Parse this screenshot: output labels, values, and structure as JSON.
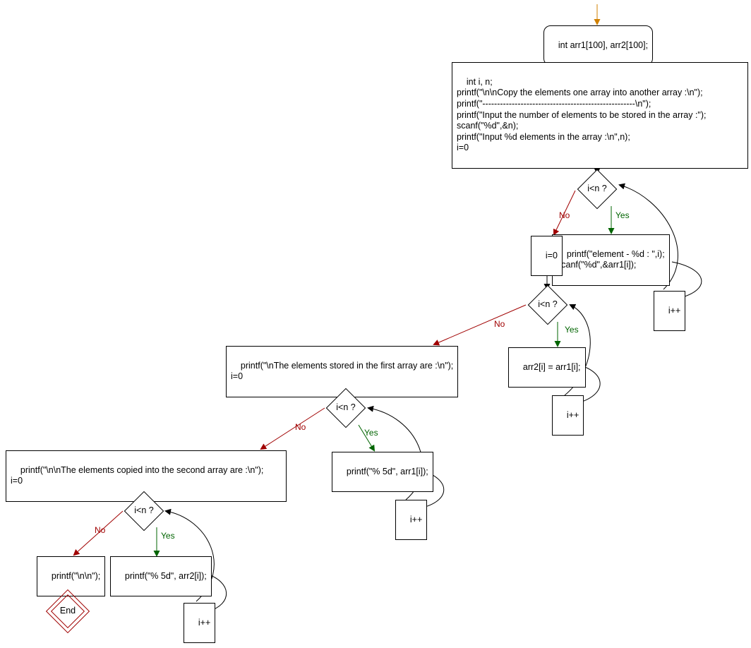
{
  "nodes": {
    "start": {
      "text": "int arr1[100], arr2[100];"
    },
    "init": {
      "text": "int i, n;\nprintf(\"\\n\\nCopy the elements one array into another array :\\n\");\nprintf(\"----------------------------------------------------\\n\");\nprintf(\"Input the number of elements to be stored in the array :\");\nscanf(\"%d\",&n);\nprintf(\"Input %d elements in the array :\\n\",n);\ni=0"
    },
    "cond1": {
      "text": "i<n ?"
    },
    "body1": {
      "text": "printf(\"element - %d : \",i);\nscanf(\"%d\",&arr1[i]);"
    },
    "inc1": {
      "text": "i++"
    },
    "reset1": {
      "text": "i=0"
    },
    "cond2": {
      "text": "i<n ?"
    },
    "body2": {
      "text": "arr2[i] = arr1[i];"
    },
    "inc2": {
      "text": "i++"
    },
    "print1": {
      "text": "printf(\"\\nThe elements stored in the first array are :\\n\");\ni=0"
    },
    "cond3": {
      "text": "i<n ?"
    },
    "body3": {
      "text": "printf(\"% 5d\", arr1[i]);"
    },
    "inc3": {
      "text": "i++"
    },
    "print2": {
      "text": "printf(\"\\n\\nThe elements copied into the second array are :\\n\");\ni=0"
    },
    "cond4": {
      "text": "i<n ?"
    },
    "body4": {
      "text": "printf(\"% 5d\", arr2[i]);"
    },
    "inc4": {
      "text": "i++"
    },
    "final": {
      "text": "printf(\"\\n\\n\");"
    },
    "end": {
      "text": "End"
    }
  },
  "labels": {
    "yes": "Yes",
    "no": "No"
  }
}
